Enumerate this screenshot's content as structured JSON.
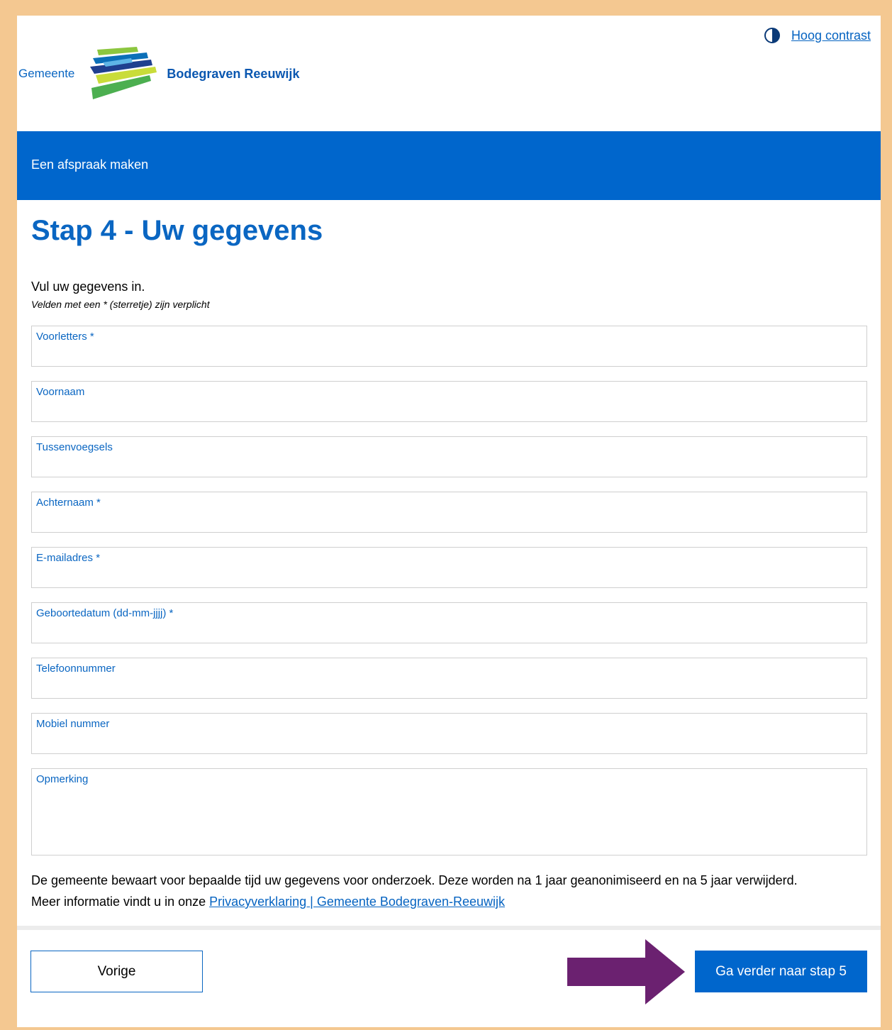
{
  "header": {
    "logo_prefix": "Gemeente",
    "logo_name": "Bodegraven Reeuwijk",
    "contrast_link": "Hoog contrast"
  },
  "banner": {
    "title": "Een afspraak maken"
  },
  "page": {
    "heading": "Stap 4 - Uw gegevens",
    "intro": "Vul uw gegevens in.",
    "required_note": "Velden met een * (sterretje) zijn verplicht"
  },
  "form": {
    "fields": [
      {
        "label": "Voorletters *",
        "value": ""
      },
      {
        "label": "Voornaam",
        "value": ""
      },
      {
        "label": "Tussenvoegsels",
        "value": ""
      },
      {
        "label": "Achternaam *",
        "value": ""
      },
      {
        "label": "E-mailadres *",
        "value": ""
      },
      {
        "label": "Geboortedatum (dd-mm-jjjj) *",
        "value": ""
      },
      {
        "label": "Telefoonnummer",
        "value": ""
      },
      {
        "label": "Mobiel nummer",
        "value": ""
      },
      {
        "label": "Opmerking",
        "value": ""
      }
    ]
  },
  "privacy": {
    "text": "De gemeente bewaart voor bepaalde tijd uw gegevens voor onderzoek. Deze worden na 1 jaar geanonimiseerd en na 5 jaar verwijderd.",
    "more_info": "Meer informatie vindt u in onze ",
    "link": "Privacyverklaring | Gemeente Bodegraven-Reeuwijk"
  },
  "nav": {
    "prev_label": "Vorige",
    "next_label": "Ga verder naar stap 5"
  },
  "colors": {
    "brand_blue": "#0066cc",
    "page_border": "#f4c891",
    "arrow": "#6b2170"
  }
}
